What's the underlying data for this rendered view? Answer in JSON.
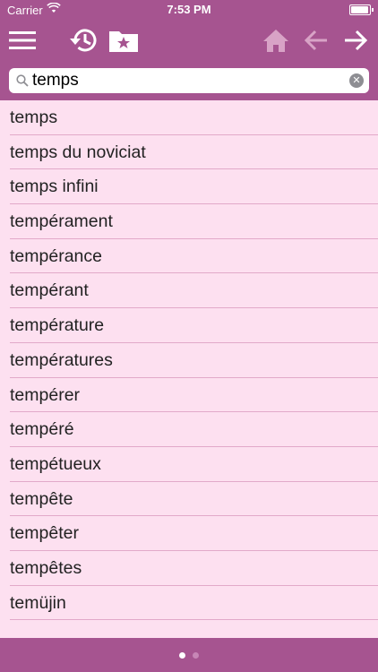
{
  "status_bar": {
    "carrier": "Carrier",
    "time": "7:53 PM"
  },
  "toolbar": {
    "menu_icon": "hamburger-menu-icon",
    "history_icon": "history-icon",
    "favorites_icon": "favorites-folder-icon",
    "home_icon": "home-icon",
    "back_icon": "arrow-left-icon",
    "forward_icon": "arrow-right-icon"
  },
  "search": {
    "value": "temps",
    "clear_icon": "clear-icon"
  },
  "results": [
    "temps",
    "temps du noviciat",
    "temps infini",
    "tempérament",
    "tempérance",
    "tempérant",
    "température",
    "températures",
    "tempérer",
    "tempéré",
    "tempétueux",
    "tempête",
    "tempêter",
    "tempêtes",
    "temüjin"
  ],
  "pager": {
    "pages": 2,
    "current": 1
  },
  "colors": {
    "accent": "#a65490",
    "background": "#fde0f0",
    "separator": "#e2a9c9",
    "disabled_icon": "#d8a3c6"
  }
}
